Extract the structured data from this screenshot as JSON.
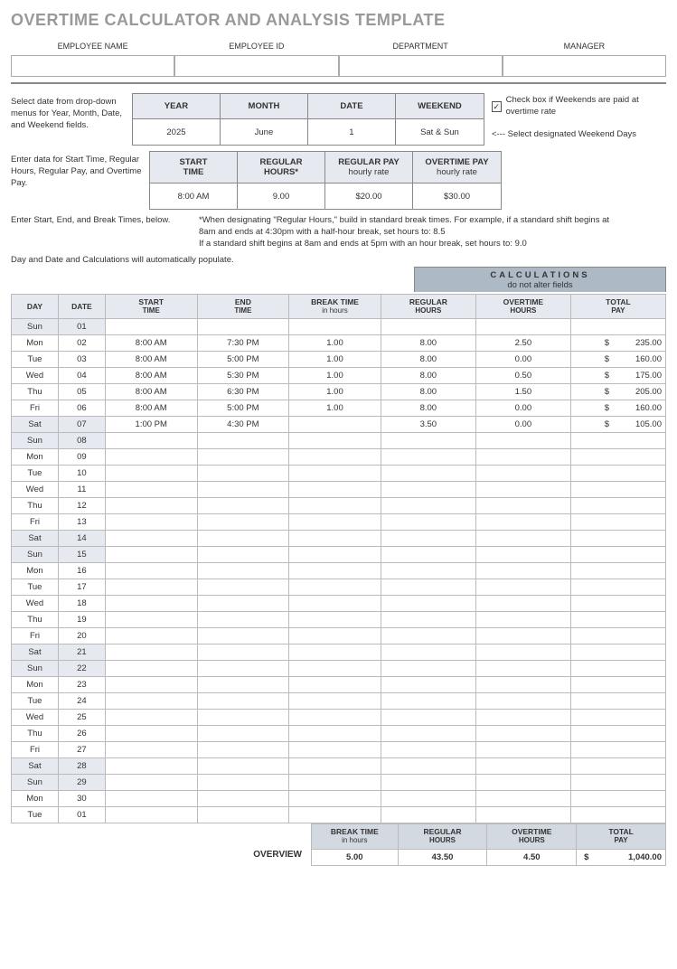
{
  "title": "OVERTIME CALCULATOR AND ANALYSIS TEMPLATE",
  "emp_headers": {
    "name": "EMPLOYEE NAME",
    "id": "EMPLOYEE ID",
    "dept": "DEPARTMENT",
    "mgr": "MANAGER"
  },
  "notes": {
    "date_select": "Select date from drop-down menus for Year, Month, Date, and Weekend fields.",
    "enter_data": "Enter data for Start Time, Regular Hours, Regular Pay, and Overtime Pay.",
    "enter_times": "Enter Start, End, and Break Times, below.",
    "auto_pop": "Day and Date and Calculations will automatically populate.",
    "check_label": "Check box if Weekends are paid at overtime rate",
    "weekend_select": "<--- Select designated Weekend Days",
    "footnote": "*When designating \"Regular Hours,\" build in standard break times. For example, if a standard shift begins at 8am and ends at 4:30pm with a half-hour break, set hours to: 8.5\nIf a standard shift begins at 8am and ends at 5pm with an hour break, set hours to: 9.0",
    "calc_title": "CALCULATIONS",
    "calc_sub": "do not alter fields"
  },
  "date_grid": {
    "headers": {
      "year": "YEAR",
      "month": "MONTH",
      "date": "DATE",
      "weekend": "WEEKEND"
    },
    "values": {
      "year": "2025",
      "month": "June",
      "date": "1",
      "weekend": "Sat & Sun"
    }
  },
  "pay_grid": {
    "headers": {
      "start": "START\nTIME",
      "reg": "REGULAR\nHOURS*",
      "regpay": "REGULAR PAY\nhourly rate",
      "otpay": "OVERTIME PAY\nhourly rate"
    },
    "values": {
      "start": "8:00 AM",
      "reg": "9.00",
      "regpay": "$20.00",
      "otpay": "$30.00"
    }
  },
  "main_headers": {
    "day": "DAY",
    "date": "DATE",
    "start": "START\nTIME",
    "end": "END\nTIME",
    "break": "BREAK TIME",
    "break_sub": "in hours",
    "reghrs": "REGULAR\nHOURS",
    "othrs": "OVERTIME\nHOURS",
    "totpay": "TOTAL\nPAY"
  },
  "rows": [
    {
      "day": "Sun",
      "date": "01",
      "weekend": true
    },
    {
      "day": "Mon",
      "date": "02",
      "start": "8:00 AM",
      "end": "7:30 PM",
      "break": "1.00",
      "reg": "8.00",
      "ot": "2.50",
      "pay": "235.00"
    },
    {
      "day": "Tue",
      "date": "03",
      "start": "8:00 AM",
      "end": "5:00 PM",
      "break": "1.00",
      "reg": "8.00",
      "ot": "0.00",
      "pay": "160.00"
    },
    {
      "day": "Wed",
      "date": "04",
      "start": "8:00 AM",
      "end": "5:30 PM",
      "break": "1.00",
      "reg": "8.00",
      "ot": "0.50",
      "pay": "175.00"
    },
    {
      "day": "Thu",
      "date": "05",
      "start": "8:00 AM",
      "end": "6:30 PM",
      "break": "1.00",
      "reg": "8.00",
      "ot": "1.50",
      "pay": "205.00"
    },
    {
      "day": "Fri",
      "date": "06",
      "start": "8:00 AM",
      "end": "5:00 PM",
      "break": "1.00",
      "reg": "8.00",
      "ot": "0.00",
      "pay": "160.00"
    },
    {
      "day": "Sat",
      "date": "07",
      "start": "1:00 PM",
      "end": "4:30 PM",
      "reg": "3.50",
      "ot": "0.00",
      "pay": "105.00",
      "weekend": true
    },
    {
      "day": "Sun",
      "date": "08",
      "weekend": true
    },
    {
      "day": "Mon",
      "date": "09"
    },
    {
      "day": "Tue",
      "date": "10"
    },
    {
      "day": "Wed",
      "date": "11"
    },
    {
      "day": "Thu",
      "date": "12"
    },
    {
      "day": "Fri",
      "date": "13"
    },
    {
      "day": "Sat",
      "date": "14",
      "weekend": true
    },
    {
      "day": "Sun",
      "date": "15",
      "weekend": true
    },
    {
      "day": "Mon",
      "date": "16"
    },
    {
      "day": "Tue",
      "date": "17"
    },
    {
      "day": "Wed",
      "date": "18"
    },
    {
      "day": "Thu",
      "date": "19"
    },
    {
      "day": "Fri",
      "date": "20"
    },
    {
      "day": "Sat",
      "date": "21",
      "weekend": true
    },
    {
      "day": "Sun",
      "date": "22",
      "weekend": true
    },
    {
      "day": "Mon",
      "date": "23"
    },
    {
      "day": "Tue",
      "date": "24"
    },
    {
      "day": "Wed",
      "date": "25"
    },
    {
      "day": "Thu",
      "date": "26"
    },
    {
      "day": "Fri",
      "date": "27"
    },
    {
      "day": "Sat",
      "date": "28",
      "weekend": true
    },
    {
      "day": "Sun",
      "date": "29",
      "weekend": true
    },
    {
      "day": "Mon",
      "date": "30"
    },
    {
      "day": "Tue",
      "date": "01"
    }
  ],
  "overview": {
    "label": "OVERVIEW",
    "headers": {
      "break": "BREAK TIME",
      "break_sub": "in hours",
      "reg": "REGULAR\nHOURS",
      "ot": "OVERTIME\nHOURS",
      "pay": "TOTAL\nPAY"
    },
    "break": "5.00",
    "reg": "43.50",
    "ot": "4.50",
    "pay": "1,040.00"
  }
}
